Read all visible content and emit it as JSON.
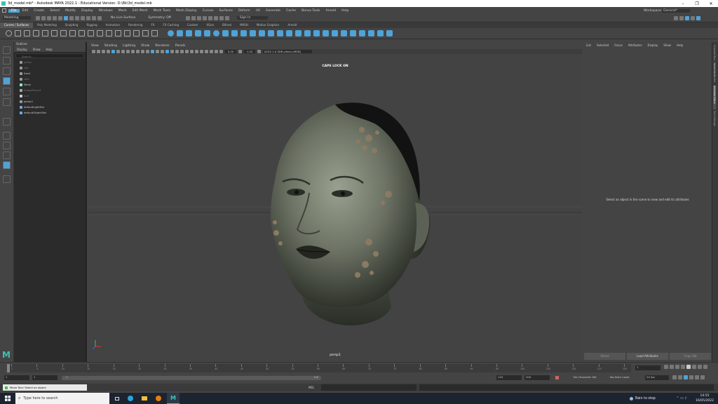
{
  "window": {
    "title": "3d_model.mb* - Autodesk MAYA 2022.1 - Educational Version: D:\\8k\\3d_model.mb",
    "controls": [
      "–",
      "❐",
      "✕"
    ]
  },
  "menubar": {
    "items": [
      "File",
      "Edit",
      "Create",
      "Select",
      "Modify",
      "Display",
      "Windows",
      "Mesh",
      "Edit Mesh",
      "Mesh Tools",
      "Mesh Display",
      "Curves",
      "Surfaces",
      "Deform",
      "UV",
      "Generate",
      "Cache",
      "Bonus Tools",
      "Arnold",
      "Help"
    ],
    "workspace_label": "Workspace:",
    "workspace_value": "General*"
  },
  "statusline": {
    "mode": "Modeling",
    "live_surface": "No Live Surface",
    "symmetry": "Symmetry: Off",
    "sign_in": "Sign In"
  },
  "shelf": {
    "tabs": [
      "Curves / Surfaces",
      "Poly Modeling",
      "Sculpting",
      "Rigging",
      "Animation",
      "Rendering",
      "FX",
      "FX Caching",
      "Custom",
      "XGen",
      "Bifrost",
      "MASH",
      "Motion Graphics",
      "Arnold"
    ],
    "active_tab": "Curves / Surfaces"
  },
  "outliner": {
    "title": "Outliner",
    "menu": [
      "Display",
      "Show",
      "Help"
    ],
    "search_placeholder": "Search...",
    "items": [
      {
        "label": "persp",
        "dim": true,
        "icon": "camera-icon"
      },
      {
        "label": "top",
        "dim": true,
        "icon": "camera-icon"
      },
      {
        "label": "front",
        "dim": false,
        "icon": "camera-icon"
      },
      {
        "label": "side",
        "dim": true,
        "icon": "camera-icon"
      },
      {
        "label": "Mesh",
        "dim": false,
        "icon": "mesh-icon"
      },
      {
        "label": "ImagePlane1",
        "dim": true,
        "icon": "image-plane-icon"
      },
      {
        "label": "null",
        "dim": true,
        "icon": "transform-icon"
      },
      {
        "label": "persp1",
        "dim": false,
        "icon": "camera-icon"
      },
      {
        "label": "defaultLightSet",
        "dim": false,
        "icon": "set-icon"
      },
      {
        "label": "defaultObjectSet",
        "dim": false,
        "icon": "set-icon"
      }
    ]
  },
  "viewport": {
    "menu": [
      "View",
      "Shading",
      "Lighting",
      "Show",
      "Renderer",
      "Panels"
    ],
    "near_value": "0.00",
    "far_value": "1.00",
    "color_space": "ACES 1.0 SDR-video (sRGB)",
    "caps_lock": "CAPS LOCK ON",
    "camera_name": "persp1"
  },
  "attribute_editor": {
    "menu": [
      "List",
      "Selected",
      "Focus",
      "Attributes",
      "Display",
      "Show",
      "Help"
    ],
    "message": "Select an object in the scene to view and edit its attributes",
    "buttons": [
      "Select",
      "Load Attributes",
      "Copy Tab"
    ]
  },
  "right_rail_tabs": [
    "Channel Box / Layer Editor",
    "Modeling Toolkit",
    "Attribute Editor",
    "Tool Settings"
  ],
  "timeslider": {
    "current_frame": "1",
    "ticks": [
      "1",
      "5",
      "10",
      "15",
      "20",
      "25",
      "30",
      "35",
      "40",
      "45",
      "50",
      "55",
      "60",
      "65",
      "70",
      "75",
      "80",
      "85",
      "90",
      "95",
      "100",
      "105",
      "110",
      "115",
      "120"
    ]
  },
  "range": {
    "start": "1",
    "inner_start": "1",
    "inner_end": "120",
    "end": "120",
    "max": "200",
    "character_set": "No Character Set",
    "anim_layer": "No Anim Layer",
    "fps": "24 fps"
  },
  "cmdline": {
    "lang": "MEL",
    "help": "Move Tool: Select an object"
  },
  "taskbar": {
    "search_placeholder": "Type here to search",
    "weather": "Rain to stop",
    "time": "14:55",
    "date": "16/05/2022"
  },
  "colors": {
    "accent": "#4fa3d8",
    "maya_logo": "#3fc0b5",
    "taskbar": "#1c2430"
  }
}
